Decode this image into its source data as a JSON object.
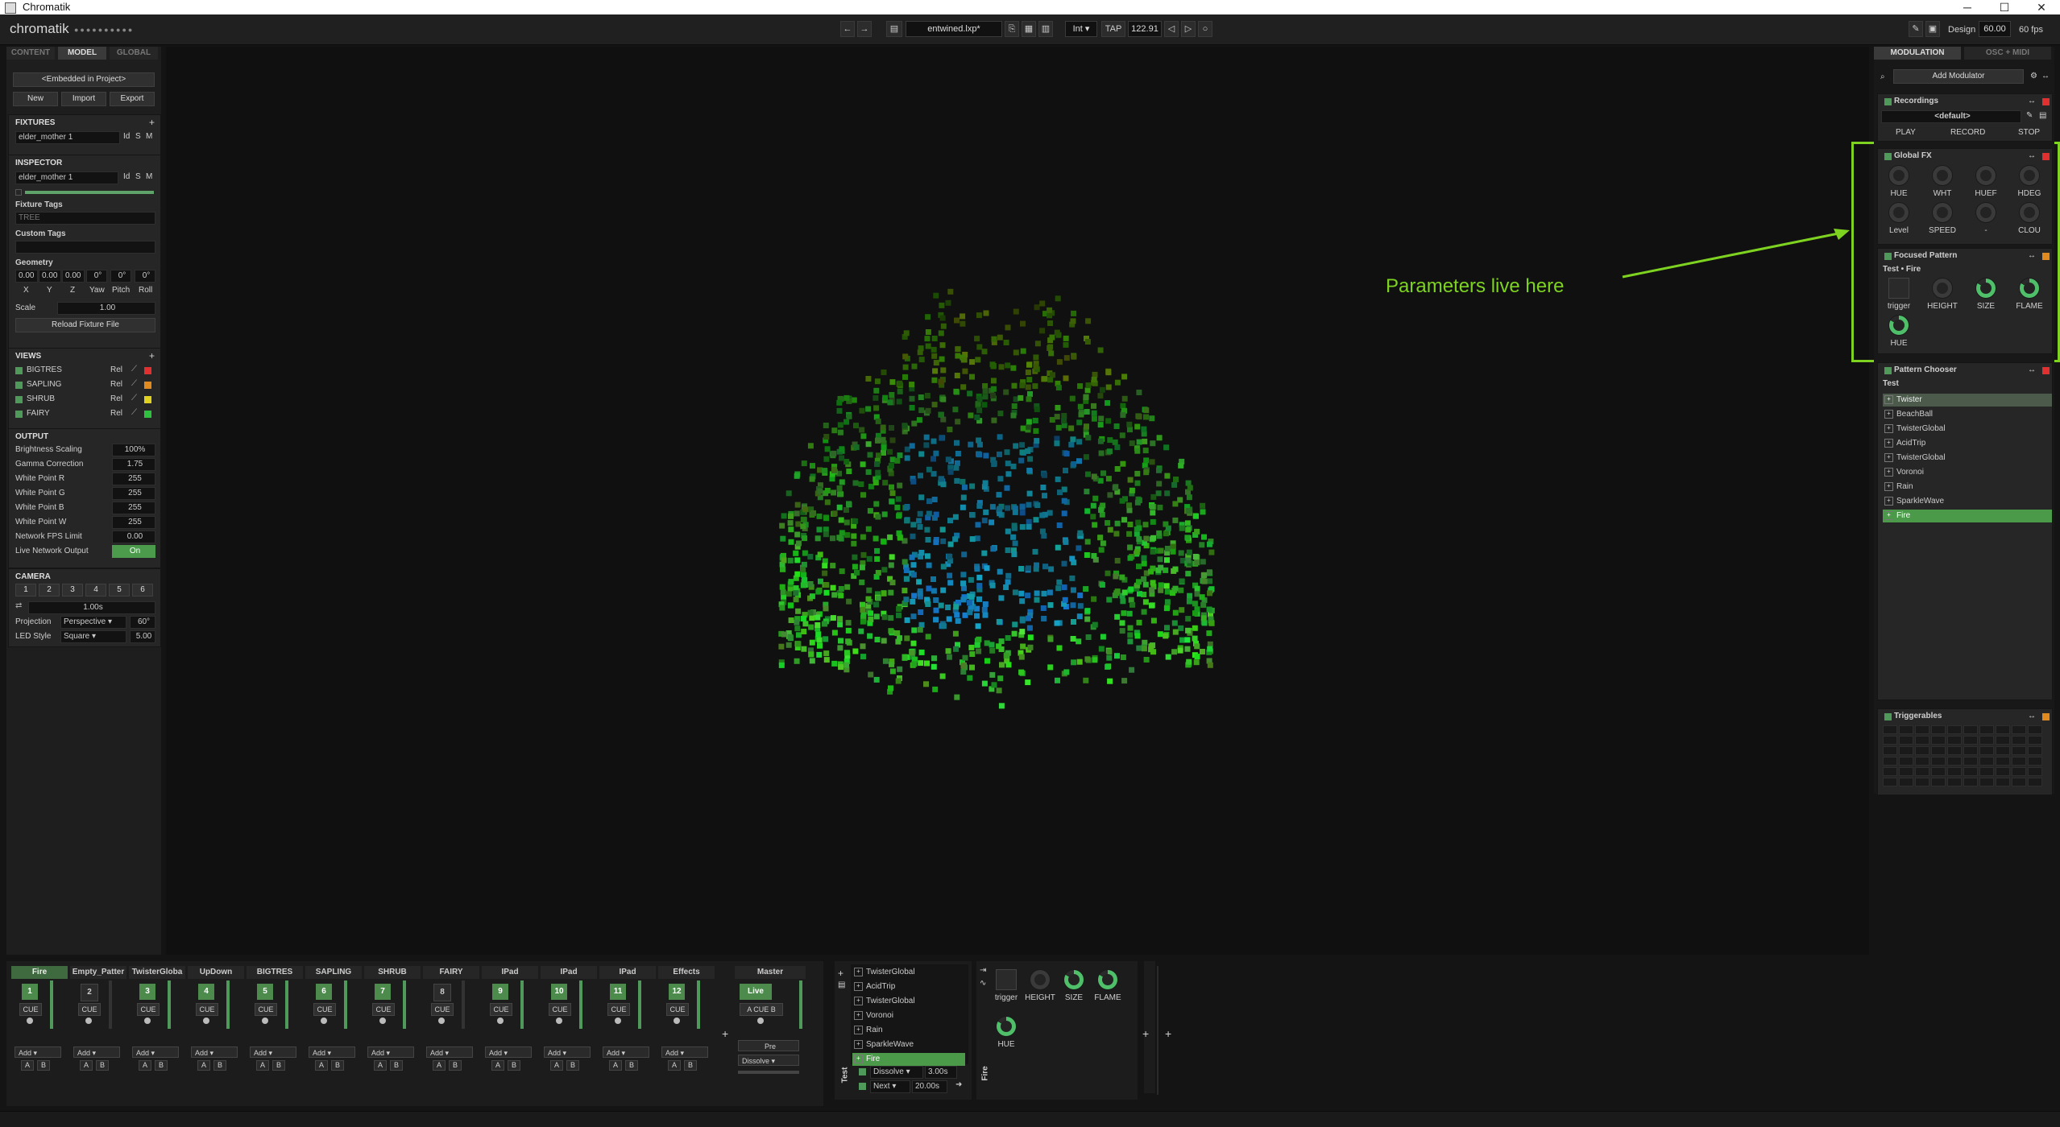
{
  "window": {
    "title": "Chromatik"
  },
  "toolbar": {
    "logo": "chromatik",
    "logo_dots": "●●●●●●●●●●",
    "project_file": "entwined.lxp*",
    "clock_mode": "Int",
    "tap_label": "TAP",
    "bpm": "122.91",
    "design_label": "Design",
    "frame_rate_value": "60.00",
    "fps_label": "60 fps"
  },
  "left": {
    "tabs": [
      "CONTENT",
      "MODEL",
      "GLOBAL"
    ],
    "model_source": "<Embedded in Project>",
    "buttons": {
      "new": "New",
      "import": "Import",
      "export": "Export"
    },
    "fixtures": {
      "title": "FIXTURES",
      "item": "elder_mother 1",
      "flags": [
        "Id",
        "S",
        "M"
      ]
    },
    "inspector": {
      "title": "INSPECTOR",
      "name": "elder_mother 1",
      "flags": [
        "Id",
        "S",
        "M"
      ],
      "fixture_tags_label": "Fixture Tags",
      "fixture_tags_value": "TREE",
      "custom_tags_label": "Custom Tags",
      "geometry_label": "Geometry",
      "geometry_values": [
        "0.00",
        "0.00",
        "0.00",
        "0°",
        "0°",
        "0°"
      ],
      "geometry_axes": [
        "X",
        "Y",
        "Z",
        "Yaw",
        "Pitch",
        "Roll"
      ],
      "scale_label": "Scale",
      "scale_value": "1.00",
      "reload_label": "Reload Fixture File"
    },
    "views": {
      "title": "VIEWS",
      "items": [
        {
          "name": "BIGTRES",
          "rel": "Rel",
          "color": "#e03030"
        },
        {
          "name": "SAPLING",
          "rel": "Rel",
          "color": "#e08a20"
        },
        {
          "name": "SHRUB",
          "rel": "Rel",
          "color": "#e0d020"
        },
        {
          "name": "FAIRY",
          "rel": "Rel",
          "color": "#30c040"
        }
      ]
    },
    "output": {
      "title": "OUTPUT",
      "rows": [
        {
          "label": "Brightness Scaling",
          "value": "100%"
        },
        {
          "label": "Gamma Correction",
          "value": "1.75"
        },
        {
          "label": "White Point R",
          "value": "255"
        },
        {
          "label": "White Point G",
          "value": "255"
        },
        {
          "label": "White Point B",
          "value": "255"
        },
        {
          "label": "White Point W",
          "value": "255"
        },
        {
          "label": "Network FPS Limit",
          "value": "0.00"
        },
        {
          "label": "Live Network Output",
          "value": "On"
        }
      ]
    },
    "camera": {
      "title": "CAMERA",
      "presets": [
        "1",
        "2",
        "3",
        "4",
        "5",
        "6"
      ],
      "duration": "1.00s",
      "projection_label": "Projection",
      "projection": "Perspective",
      "fov": "60°",
      "led_style_label": "LED Style",
      "led_style": "Square",
      "led_size": "5.00"
    }
  },
  "annotation": {
    "text": "Parameters live here",
    "color": "#7ed321"
  },
  "right": {
    "tabs": [
      "MODULATION",
      "OSC + MIDI"
    ],
    "add_modulator": "Add Modulator",
    "recordings": {
      "title": "Recordings",
      "default": "<default>",
      "play": "PLAY",
      "record": "RECORD",
      "stop": "STOP"
    },
    "global_fx": {
      "title": "Global FX",
      "knobs": [
        "HUE",
        "WHT",
        "HUEF",
        "HDEG",
        "Level",
        "SPEED",
        "-",
        "CLOU"
      ]
    },
    "focused_pattern": {
      "title": "Focused Pattern",
      "subtitle": "Test • Fire",
      "knobs": [
        "trigger",
        "HEIGHT",
        "SIZE",
        "FLAME",
        "HUE"
      ]
    },
    "pattern_chooser": {
      "title": "Pattern Chooser",
      "channel": "Test",
      "items": [
        "Twister",
        "BeachBall",
        "TwisterGlobal",
        "AcidTrip",
        "TwisterGlobal",
        "Voronoi",
        "Rain",
        "SparkleWave",
        "Fire"
      ]
    },
    "triggerables": {
      "title": "Triggerables"
    }
  },
  "mixer": {
    "channels": [
      {
        "name": "Fire",
        "num": "1",
        "active": true
      },
      {
        "name": "Empty_Patter",
        "num": "2",
        "active": false
      },
      {
        "name": "TwisterGloba",
        "num": "3",
        "active": true
      },
      {
        "name": "UpDown",
        "num": "4",
        "active": true
      },
      {
        "name": "BIGTRES",
        "num": "5",
        "active": true
      },
      {
        "name": "SAPLING",
        "num": "6",
        "active": true
      },
      {
        "name": "SHRUB",
        "num": "7",
        "active": true
      },
      {
        "name": "FAIRY",
        "num": "8",
        "active": false
      },
      {
        "name": "IPad",
        "num": "9",
        "active": true
      },
      {
        "name": "IPad",
        "num": "10",
        "active": true
      },
      {
        "name": "IPad",
        "num": "11",
        "active": true
      },
      {
        "name": "Effects",
        "num": "12",
        "active": true
      }
    ],
    "cue_label": "CUE",
    "add_label": "Add",
    "a_label": "A",
    "b_label": "B",
    "master": {
      "name": "Master",
      "live": "Live",
      "pre": "Pre",
      "blend": "Dissolve"
    }
  },
  "clip_panel": {
    "channel": "Test",
    "items": [
      "TwisterGlobal",
      "AcidTrip",
      "TwisterGlobal",
      "Voronoi",
      "Rain",
      "SparkleWave",
      "Fire"
    ],
    "transition": "Dissolve",
    "transition_time": "3.00s",
    "next": "Next",
    "next_time": "20.00s"
  },
  "device_panel": {
    "name": "Fire",
    "knobs": [
      "trigger",
      "HEIGHT",
      "SIZE",
      "FLAME",
      "HUE"
    ]
  }
}
